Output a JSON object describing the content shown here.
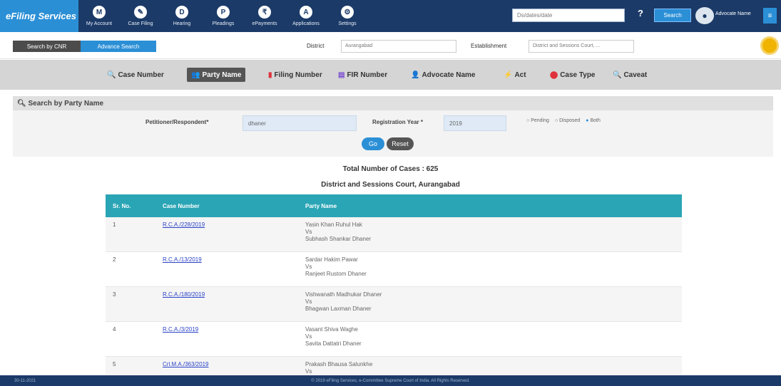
{
  "topbar": {
    "brand": "eFiling Services",
    "nav": [
      {
        "icon": "M",
        "label": "My Account"
      },
      {
        "icon": "✎",
        "label": "Case Filing"
      },
      {
        "icon": "D",
        "label": "Hearing"
      },
      {
        "icon": "P",
        "label": "Pleadings"
      },
      {
        "icon": "₹",
        "label": "ePayments"
      },
      {
        "icon": "A",
        "label": "Applications"
      },
      {
        "icon": "⚙",
        "label": "Settings"
      }
    ],
    "search_placeholder": "Ds/dates/date",
    "help": "?",
    "search_button": "Search",
    "username": "Advocate Name",
    "menu_icon": "≡"
  },
  "row2": {
    "search_by_cnr": "Search by CNR",
    "advance_search": "Advance Search",
    "district_label": "District",
    "district_value": "Aurangabad",
    "establishment_label": "Establishment",
    "establishment_value": "District and Sessions Court, ..."
  },
  "search_types": [
    {
      "icon": "🔍",
      "label": "Case Number",
      "color": "#2b8fd6"
    },
    {
      "icon": "👥",
      "label": "Party Name",
      "color": "#f0a020",
      "active": true
    },
    {
      "icon": "▮",
      "label": "Filing Number",
      "color": "#e0323c"
    },
    {
      "icon": "▤",
      "label": "FIR Number",
      "color": "#7a4fd0"
    },
    {
      "icon": "👤",
      "label": "Advocate Name",
      "color": "#2fa84f"
    },
    {
      "icon": "⚡",
      "label": "Act",
      "color": "#f0a020"
    },
    {
      "icon": "⬤",
      "label": "Case Type",
      "color": "#e0323c"
    },
    {
      "icon": "🔍",
      "label": "Caveat",
      "color": "#2aa5b5"
    }
  ],
  "form": {
    "title": "Search by Party Name",
    "party_label": "Petitioner/Respondent*",
    "party_value": "dhaner",
    "year_label": "Registration Year *",
    "year_value": "2019",
    "status_options": [
      "Pending",
      "Disposed",
      "Both"
    ],
    "go_label": "Go",
    "reset_label": "Reset"
  },
  "results": {
    "total": "Total Number of Cases : 625",
    "court": "District and Sessions Court, Aurangabad",
    "columns": [
      "Sr. No.",
      "Case Number",
      "Party Name"
    ],
    "rows": [
      {
        "sr": "1",
        "case": "R.C.A./228/2019",
        "pet": "Yasin Khan Ruhul Hak",
        "vs": "Vs",
        "res": "Subhash Shankar Dhaner"
      },
      {
        "sr": "2",
        "case": "R.C.A./13/2019",
        "pet": "Sardar Hakim Pawar",
        "vs": "Vs",
        "res": "Ranjeet Rustom Dhaner"
      },
      {
        "sr": "3",
        "case": "R.C.A./180/2019",
        "pet": "Vishwanath Madhukar Dhaner",
        "vs": "Vs",
        "res": "Bhagwan Laxman Dhaner"
      },
      {
        "sr": "4",
        "case": "R.C.A./3/2019",
        "pet": "Vasant Shiva Waghe",
        "vs": "Vs",
        "res": "Savita Dattatri Dhaner"
      },
      {
        "sr": "5",
        "case": "Crl.M.A./363/2019",
        "pet": "Prakash Bhausa Salunkhe",
        "vs": "Vs",
        "res": ""
      }
    ]
  },
  "footer": {
    "left": "30-11-2021",
    "copyright": "© 2019 eFiling Services, e-Committee Supreme Court of India. All Rights Reserved."
  }
}
